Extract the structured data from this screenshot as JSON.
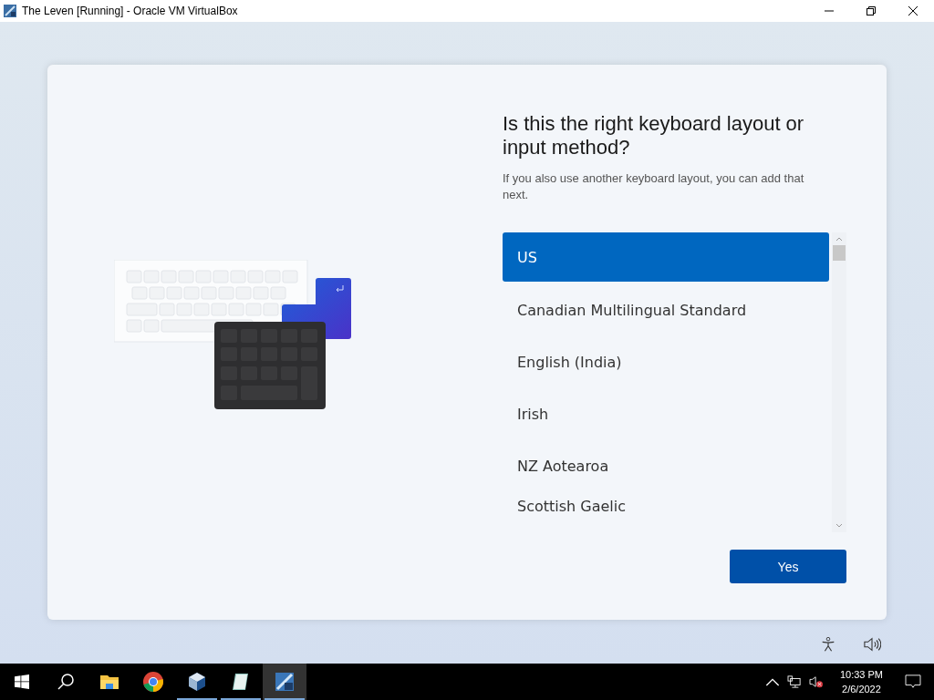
{
  "window": {
    "title": "The Leven [Running] - Oracle VM VirtualBox"
  },
  "setup": {
    "heading": "Is this the right keyboard layout or input method?",
    "subtext": "If you also use another keyboard layout, you can add that next.",
    "layouts": [
      {
        "label": "US",
        "selected": true
      },
      {
        "label": "Canadian Multilingual Standard",
        "selected": false
      },
      {
        "label": "English (India)",
        "selected": false
      },
      {
        "label": "Irish",
        "selected": false
      },
      {
        "label": "NZ Aotearoa",
        "selected": false
      },
      {
        "label": "Scottish Gaelic",
        "selected": false
      }
    ],
    "button": "Yes"
  },
  "taskbar": {
    "apps": [
      {
        "kind": "folder",
        "running": false,
        "selected": false
      },
      {
        "kind": "browser",
        "running": false,
        "selected": false
      },
      {
        "kind": "cube",
        "running": true,
        "selected": false
      },
      {
        "kind": "notepad",
        "running": true,
        "selected": false
      },
      {
        "kind": "vm",
        "running": true,
        "selected": true
      }
    ],
    "time": "10:33 PM",
    "date": "2/6/2022"
  }
}
